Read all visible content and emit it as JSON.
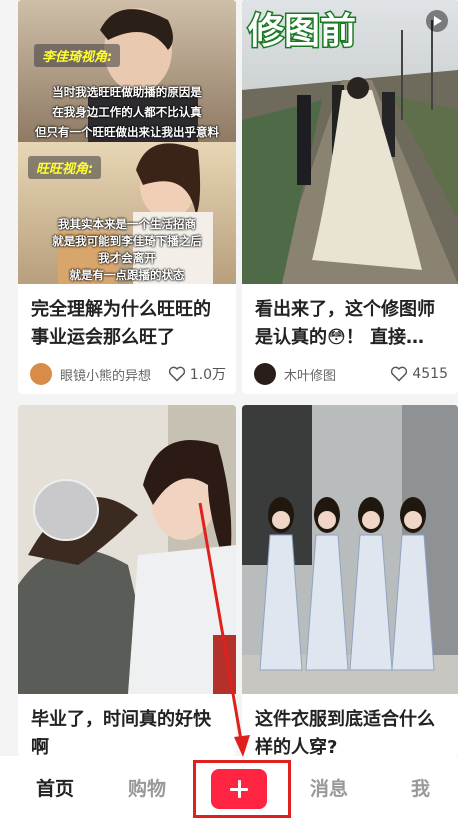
{
  "cards": [
    {
      "title": "完全理解为什么旺旺的事业运会那么旺了",
      "author": "眼镜小熊的异想",
      "likes": "1.0万",
      "image": {
        "badge_top": "李佳琦视角:",
        "caption_top": [
          "当时我选旺旺做助播的原因是",
          "在我身边工作的人都不比认真",
          "但只有一个旺旺做出来让我出乎意料"
        ],
        "badge_bottom": "旺旺视角:",
        "caption_bottom": [
          "我其实本来是一个生活招商",
          "就是我可能到李佳琦下播之后",
          "我才会离开",
          "就是有一点跟播的状态"
        ]
      }
    },
    {
      "title": "看出来了，这个修图师是认真的😳！ 直接…",
      "author": "木叶修图",
      "likes": "4515",
      "image": {
        "overlay_text": "修图前"
      }
    },
    {
      "title": "毕业了，时间真的好快啊",
      "author": "",
      "likes": "",
      "image": {}
    },
    {
      "title": "这件衣服到底适合什么样的人穿?",
      "author": "",
      "likes": "",
      "image": {}
    }
  ],
  "tabbar": {
    "home": "首页",
    "shop": "购物",
    "messages": "消息",
    "me": "我"
  },
  "colors": {
    "accent": "#ff2442",
    "annotation": "#e0211b"
  }
}
